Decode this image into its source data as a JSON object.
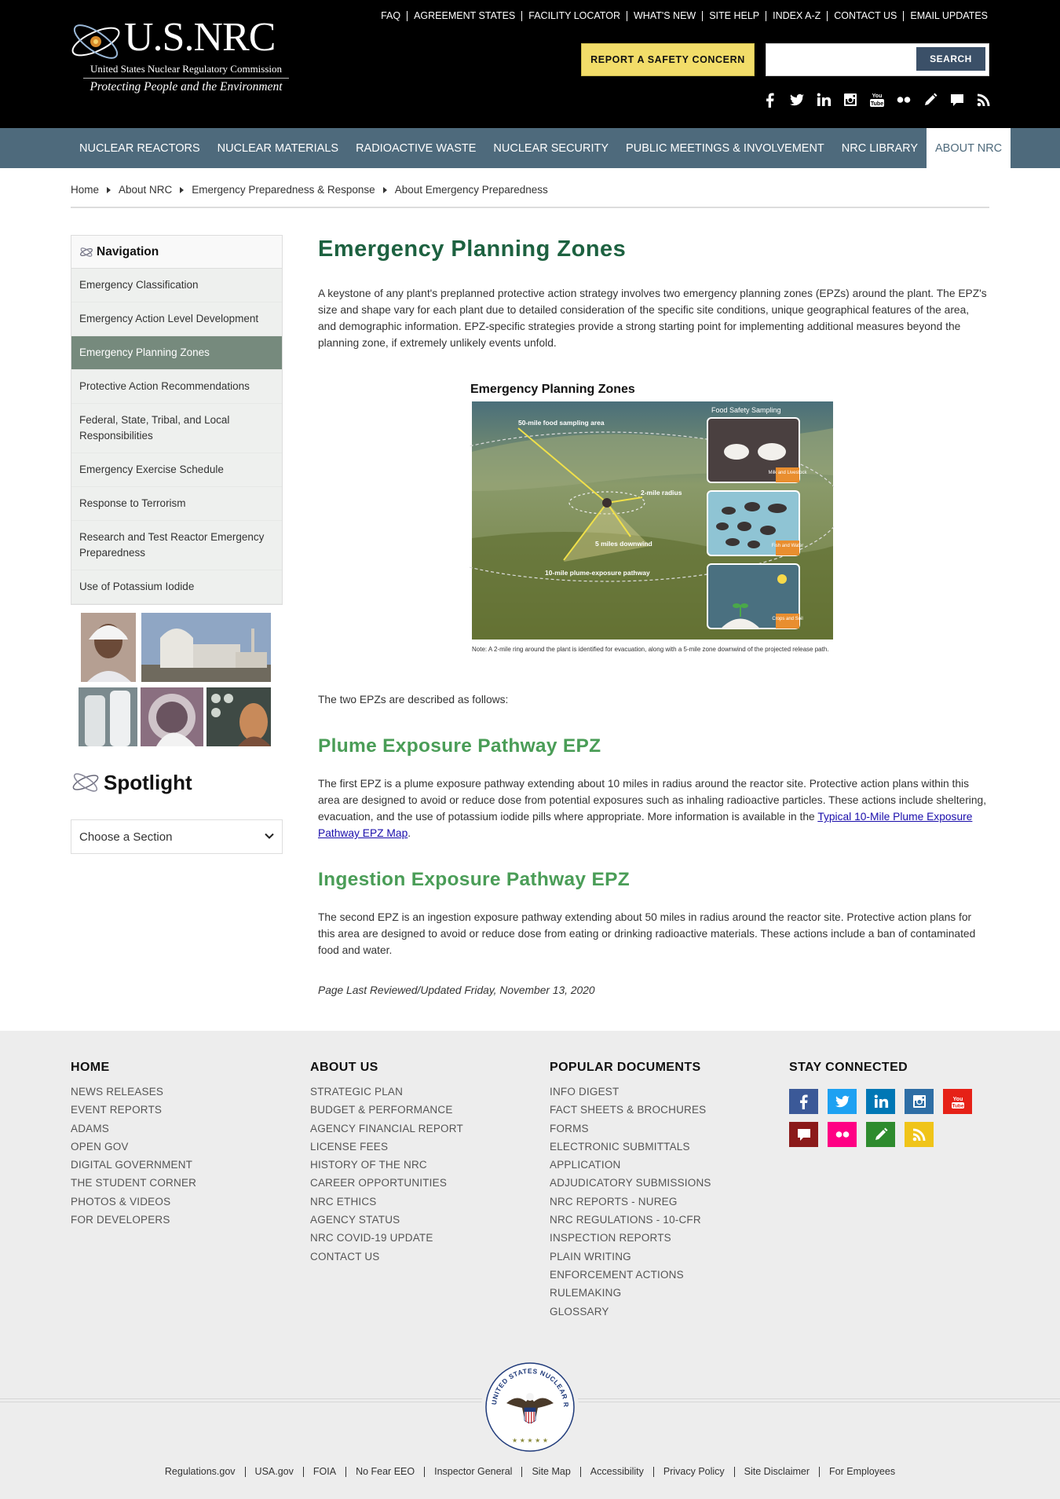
{
  "header": {
    "logo_title": "U.S.NRC",
    "logo_subtitle": "United States Nuclear Regulatory Commission",
    "logo_tagline": "Protecting People and the Environment",
    "utility_links": [
      "FAQ",
      "AGREEMENT STATES",
      "FACILITY LOCATOR",
      "WHAT'S NEW",
      "SITE HELP",
      "INDEX A-Z",
      "CONTACT US",
      "EMAIL UPDATES"
    ],
    "report_button": "REPORT A SAFETY CONCERN",
    "search_placeholder": "",
    "search_button": "SEARCH",
    "social_icons": [
      "facebook-icon",
      "twitter-icon",
      "linkedin-icon",
      "instagram-icon",
      "youtube-icon",
      "flickr-icon",
      "pencil-icon",
      "comment-icon",
      "rss-icon"
    ]
  },
  "mainnav": {
    "items": [
      "NUCLEAR REACTORS",
      "NUCLEAR MATERIALS",
      "RADIOACTIVE WASTE",
      "NUCLEAR SECURITY",
      "PUBLIC MEETINGS & INVOLVEMENT",
      "NRC LIBRARY",
      "ABOUT NRC"
    ],
    "active": "ABOUT NRC"
  },
  "breadcrumb": [
    "Home",
    "About NRC",
    "Emergency Preparedness & Response",
    "About Emergency Preparedness"
  ],
  "sidebar": {
    "heading": "Navigation",
    "items": [
      "Emergency Classification",
      "Emergency Action Level Development",
      "Emergency Planning Zones",
      "Protective Action Recommendations",
      "Federal, State, Tribal, and Local Responsibilities",
      "Emergency Exercise Schedule",
      "Response to Terrorism",
      "Research and Test Reactor Emergency Preparedness",
      "Use of Potassium Iodide"
    ],
    "active_item": "Emergency Planning Zones",
    "spotlight_heading": "Spotlight",
    "section_select": "Choose a Section"
  },
  "main": {
    "title": "Emergency Planning Zones",
    "intro": "A keystone of any plant's preplanned protective action strategy involves two emergency planning zones (EPZs) around the plant. The EPZ's size and shape vary for each plant due to detailed consideration of the specific site conditions, unique geographical features of the area, and demographic information. EPZ-specific strategies provide a strong starting point for implementing additional measures beyond the planning zone, if extremely unlikely events unfold.",
    "figure": {
      "title": "Emergency Planning Zones",
      "panel_title": "Food Safety Sampling",
      "label_50mile": "50-mile food sampling area",
      "label_2mile": "2-mile radius",
      "label_5mile": "5 miles downwind",
      "label_10mile": "10-mile plume-exposure pathway",
      "tag_milk": "Milk and Livestock",
      "tag_fish": "Fish and Water",
      "tag_crops": "Crops and Soil",
      "note": "Note: A 2-mile ring around the plant is identified for evacuation, along with a 5-mile zone downwind of the projected release path."
    },
    "epz_intro": "The two EPZs are described as follows:",
    "section1_title": "Plume Exposure Pathway EPZ",
    "section1_text": "The first EPZ is a plume exposure pathway extending about 10 miles in radius around the reactor site. Protective action plans within this area are designed to avoid or reduce dose from potential exposures such as inhaling radioactive particles. These actions include sheltering, evacuation, and the use of potassium iodide pills where appropriate. More information is available in the ",
    "section1_link": "Typical 10-Mile Plume Exposure Pathway EPZ Map",
    "section1_end": ".",
    "section2_title": "Ingestion Exposure Pathway EPZ",
    "section2_text": "The second EPZ is an ingestion exposure pathway extending about 50 miles in radius around the reactor site. Protective action plans for this area are designed to avoid or reduce dose from eating or drinking radioactive materials. These actions include a ban of contaminated food and water.",
    "last_reviewed": "Page Last Reviewed/Updated Friday, November 13, 2020"
  },
  "footer": {
    "home": {
      "heading": "HOME",
      "links": [
        "NEWS RELEASES",
        "EVENT REPORTS",
        "ADAMS",
        "OPEN GOV",
        "DIGITAL GOVERNMENT",
        "THE STUDENT CORNER",
        "PHOTOS & VIDEOS",
        "FOR DEVELOPERS"
      ]
    },
    "about": {
      "heading": "ABOUT US",
      "links": [
        "STRATEGIC PLAN",
        "BUDGET & PERFORMANCE",
        "AGENCY FINANCIAL REPORT",
        "LICENSE FEES",
        "HISTORY OF THE NRC",
        "CAREER OPPORTUNITIES",
        "NRC ETHICS",
        "AGENCY STATUS",
        "NRC COVID-19 UPDATE",
        "CONTACT US"
      ]
    },
    "popular": {
      "heading": "POPULAR DOCUMENTS",
      "links": [
        "INFO DIGEST",
        "FACT SHEETS & BROCHURES",
        "FORMS",
        "ELECTRONIC SUBMITTALS",
        "APPLICATION",
        "ADJUDICATORY SUBMISSIONS",
        "NRC REPORTS - NUREG",
        "NRC REGULATIONS - 10-CFR",
        "INSPECTION REPORTS",
        "PLAIN WRITING",
        "ENFORCEMENT ACTIONS",
        "RULEMAKING",
        "GLOSSARY"
      ]
    },
    "connect": {
      "heading": "STAY CONNECTED",
      "icons": [
        {
          "name": "facebook-icon",
          "color": "#3b5998"
        },
        {
          "name": "twitter-icon",
          "color": "#1da1f2"
        },
        {
          "name": "linkedin-icon",
          "color": "#0077b5"
        },
        {
          "name": "instagram-icon",
          "color": "#2e6ea5"
        },
        {
          "name": "youtube-icon",
          "color": "#e62117"
        },
        {
          "name": "comment-icon",
          "color": "#8b1a1a"
        },
        {
          "name": "flickr-icon",
          "color": "#ff0084"
        },
        {
          "name": "pencil-icon",
          "color": "#2e8b2e"
        },
        {
          "name": "rss-icon",
          "color": "#f0c419"
        }
      ]
    },
    "seal_text": "UNITED STATES NUCLEAR REGULATORY COMMISSION",
    "bottom_links": [
      "Regulations.gov",
      "USA.gov",
      "FOIA",
      "No Fear EEO",
      "Inspector General",
      "Site Map",
      "Accessibility",
      "Privacy Policy",
      "Site Disclaimer",
      "For Employees"
    ]
  }
}
